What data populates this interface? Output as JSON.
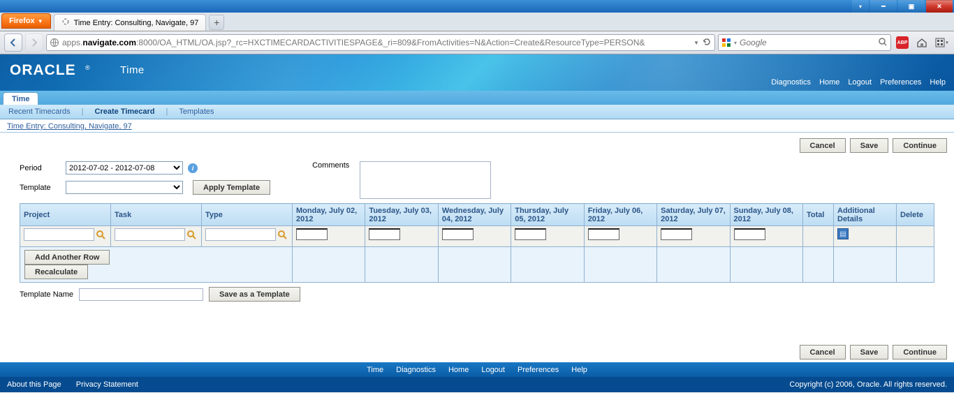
{
  "window": {
    "firefox_label": "Firefox",
    "tab_title": "Time Entry: Consulting, Navigate, 97",
    "url_pre": "apps.",
    "url_host": "navigate.com",
    "url_path": ":8000/OA_HTML/OA.jsp?_rc=HXCTIMECARDACTIVITIESPAGE&_ri=809&FromActivities=N&Action=Create&ResourceType=PERSON&",
    "search_placeholder": "Google"
  },
  "header": {
    "brand": "ORACLE",
    "brand_sub": "Time",
    "links": {
      "diagnostics": "Diagnostics",
      "home": "Home",
      "logout": "Logout",
      "preferences": "Preferences",
      "help": "Help"
    }
  },
  "tabs": {
    "main": "Time"
  },
  "subnav": {
    "recent": "Recent Timecards",
    "create": "Create Timecard",
    "templates": "Templates"
  },
  "breadcrumb": "Time Entry: Consulting, Navigate, 97",
  "actions": {
    "cancel": "Cancel",
    "save": "Save",
    "continue": "Continue"
  },
  "form": {
    "period_label": "Period",
    "period_value": "2012-07-02 - 2012-07-08",
    "template_label": "Template",
    "apply_template": "Apply Template",
    "comments_label": "Comments"
  },
  "grid": {
    "headers": {
      "project": "Project",
      "task": "Task",
      "type": "Type",
      "d0": "Monday, July 02, 2012",
      "d1": "Tuesday, July 03, 2012",
      "d2": "Wednesday, July 04, 2012",
      "d3": "Thursday, July 05, 2012",
      "d4": "Friday, July 06, 2012",
      "d5": "Saturday, July 07, 2012",
      "d6": "Sunday, July 08, 2012",
      "total": "Total",
      "additional": "Additional Details",
      "delete": "Delete"
    },
    "add_row": "Add Another Row",
    "recalculate": "Recalculate"
  },
  "template_save": {
    "label": "Template Name",
    "button": "Save as a Template"
  },
  "footer": {
    "links": {
      "time": "Time",
      "diagnostics": "Diagnostics",
      "home": "Home",
      "logout": "Logout",
      "preferences": "Preferences",
      "help": "Help"
    },
    "about": "About this Page",
    "privacy": "Privacy Statement",
    "copyright": "Copyright (c) 2006, Oracle. All rights reserved."
  }
}
